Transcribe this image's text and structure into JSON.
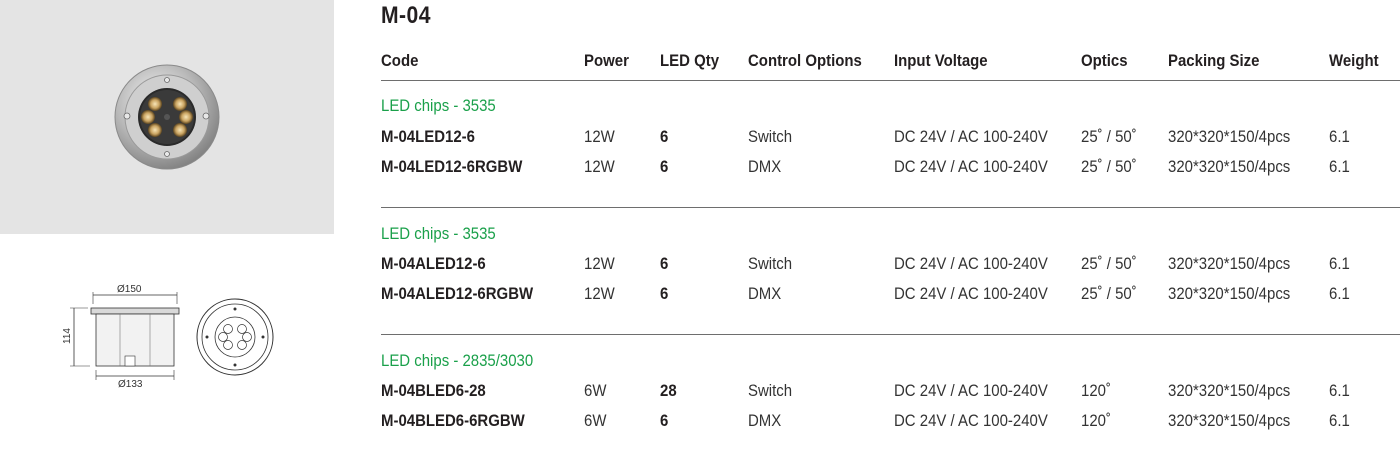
{
  "title": "M-04",
  "headers": {
    "code": "Code",
    "power": "Power",
    "led_qty": "LED Qty",
    "control": "Control Options",
    "voltage": "Input Voltage",
    "optics": "Optics",
    "packing": "Packing Size",
    "weight": "Weight"
  },
  "groups": [
    {
      "label": "LED chips - 3535",
      "rows": [
        {
          "code": "M-04LED12-6",
          "power": "12W",
          "qty": "6",
          "control": "Switch",
          "voltage": "DC 24V / AC 100-240V",
          "optics": "25˚ / 50˚",
          "packing": "320*320*150/4pcs",
          "weight": "6.1"
        },
        {
          "code": "M-04LED12-6RGBW",
          "power": "12W",
          "qty": "6",
          "control": "DMX",
          "voltage": "DC 24V / AC 100-240V",
          "optics": "25˚ / 50˚",
          "packing": "320*320*150/4pcs",
          "weight": "6.1"
        }
      ]
    },
    {
      "label": "LED chips - 3535",
      "rows": [
        {
          "code": "M-04ALED12-6",
          "power": "12W",
          "qty": "6",
          "control": "Switch",
          "voltage": "DC 24V / AC 100-240V",
          "optics": "25˚ / 50˚",
          "packing": "320*320*150/4pcs",
          "weight": "6.1"
        },
        {
          "code": "M-04ALED12-6RGBW",
          "power": "12W",
          "qty": "6",
          "control": "DMX",
          "voltage": "DC 24V / AC 100-240V",
          "optics": "25˚ / 50˚",
          "packing": "320*320*150/4pcs",
          "weight": "6.1"
        }
      ]
    },
    {
      "label": "LED chips - 2835/3030",
      "rows": [
        {
          "code": "M-04BLED6-28",
          "power": "6W",
          "qty": "28",
          "control": "Switch",
          "voltage": "DC 24V / AC 100-240V",
          "optics": "120˚",
          "packing": "320*320*150/4pcs",
          "weight": "6.1"
        },
        {
          "code": "M-04BLED6-6RGBW",
          "power": "6W",
          "qty": "6",
          "control": "DMX",
          "voltage": "DC 24V / AC 100-240V",
          "optics": "120˚",
          "packing": "320*320*150/4pcs",
          "weight": "6.1"
        }
      ]
    }
  ],
  "drawing": {
    "top_diameter": "Ø150",
    "bottom_diameter": "Ø133",
    "height": "114"
  },
  "colors": {
    "group_label": "#1aa04a",
    "photo_background": "#e4e4e4",
    "rule": "#6e6e6e"
  }
}
